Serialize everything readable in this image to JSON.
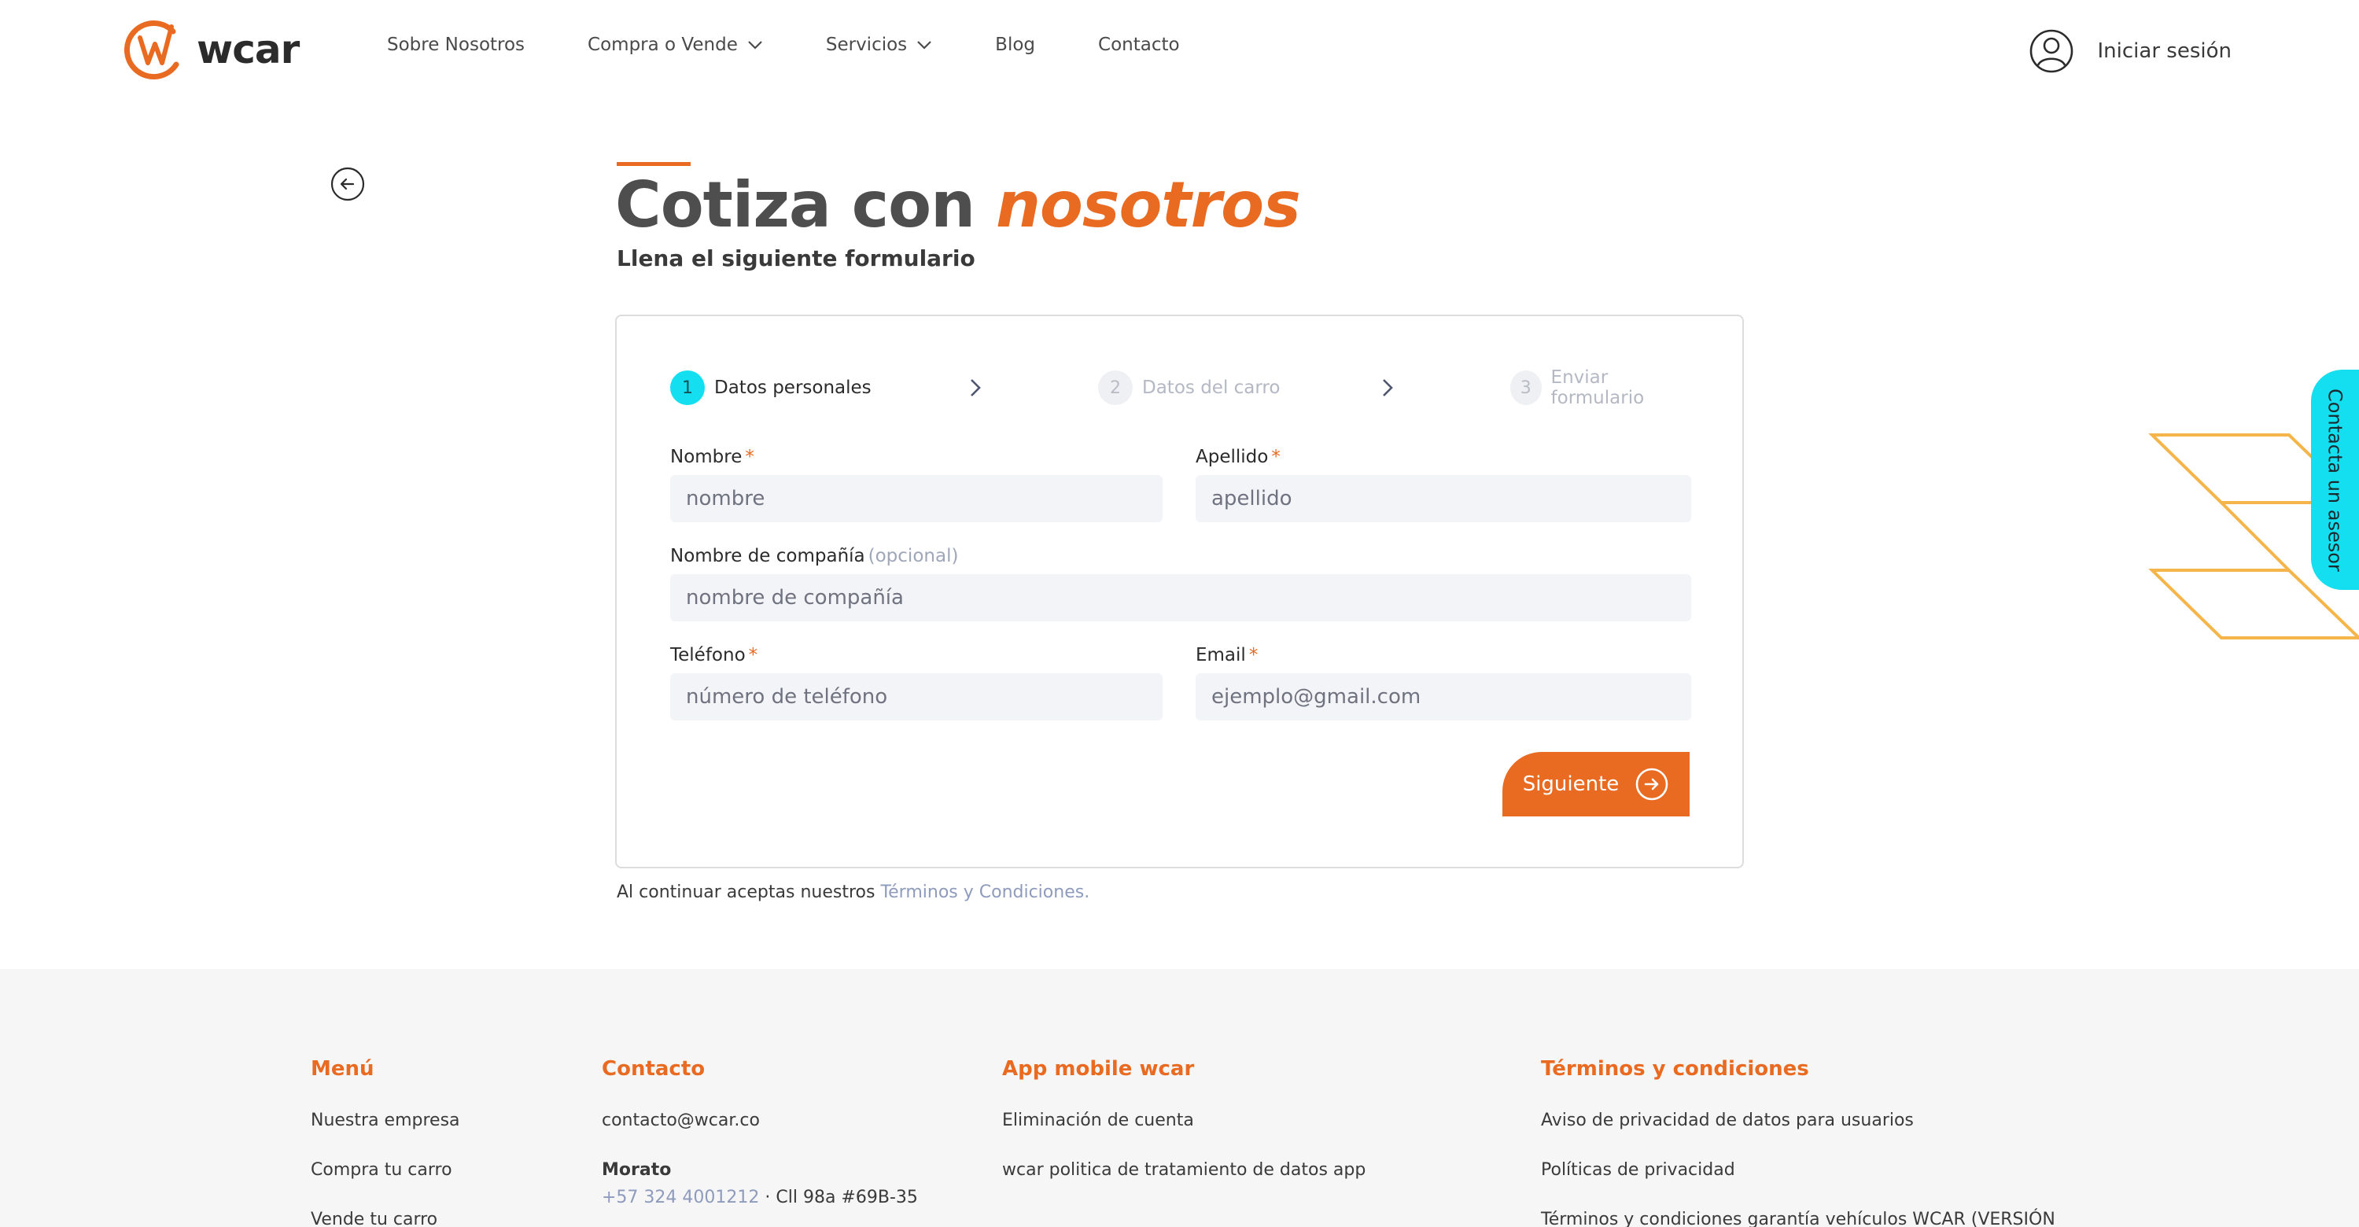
{
  "brand": {
    "name": "wcar",
    "accent": "#e96b22",
    "cyan": "#14dff0"
  },
  "nav": {
    "items": [
      {
        "label": "Sobre Nosotros",
        "dropdown": false
      },
      {
        "label": "Compra o Vende",
        "dropdown": true
      },
      {
        "label": "Servicios",
        "dropdown": true
      },
      {
        "label": "Blog",
        "dropdown": false
      },
      {
        "label": "Contacto",
        "dropdown": false
      }
    ],
    "login_label": "Iniciar sesión"
  },
  "page": {
    "title_main": "Cotiza con",
    "title_accent": "nosotros",
    "subtitle": "Llena el siguiente formulario"
  },
  "steps": [
    {
      "num": "1",
      "label": "Datos personales",
      "active": true
    },
    {
      "num": "2",
      "label": "Datos del carro",
      "active": false
    },
    {
      "num": "3",
      "label": "Enviar formulario",
      "active": false
    }
  ],
  "form": {
    "nombre": {
      "label": "Nombre",
      "required": "*",
      "placeholder": "nombre"
    },
    "apellido": {
      "label": "Apellido",
      "required": "*",
      "placeholder": "apellido"
    },
    "compania": {
      "label": "Nombre de compañía",
      "optional": "(opcional)",
      "placeholder": "nombre de compañía"
    },
    "telefono": {
      "label": "Teléfono",
      "required": "*",
      "placeholder": "número de teléfono"
    },
    "email": {
      "label": "Email",
      "required": "*",
      "placeholder": "ejemplo@gmail.com"
    },
    "next_label": "Siguiente"
  },
  "terms": {
    "prefix": "Al continuar aceptas nuestros",
    "link": "Términos y Condiciones."
  },
  "advisor_tab": "Contacta un asesor",
  "footer": {
    "menu": {
      "title": "Menú",
      "items": [
        "Nuestra empresa",
        "Compra tu carro",
        "Vende tu carro"
      ]
    },
    "contacto": {
      "title": "Contacto",
      "email": "contacto@wcar.co",
      "location": "Morato",
      "phone": "+57 324 4001212",
      "address": " · Cll 98a #69B-35"
    },
    "app": {
      "title": "App mobile wcar",
      "items": [
        "Eliminación de cuenta",
        "wcar politica de tratamiento de datos app"
      ]
    },
    "terminos": {
      "title": "Términos y condiciones",
      "items": [
        "Aviso de privacidad de datos para usuarios",
        "Políticas de privacidad",
        "Términos y condiciones garantía vehículos WCAR (VERSIÓN"
      ]
    }
  }
}
